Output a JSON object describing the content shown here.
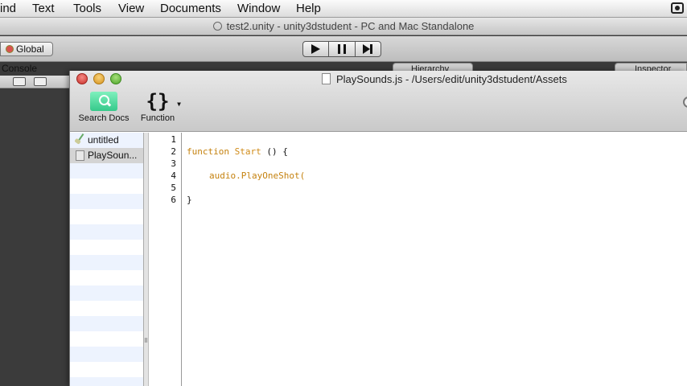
{
  "menu": [
    "ind",
    "Text",
    "Tools",
    "View",
    "Documents",
    "Window",
    "Help"
  ],
  "unity": {
    "title": "test2.unity - unity3dstudent - PC and Mac Standalone",
    "global_label": "Global",
    "console_tab": "Console",
    "hierarchy_tab": "Hierarchy",
    "inspector_tab": "Inspector"
  },
  "editor": {
    "title": "PlaySounds.js - /Users/edit/unity3dstudent/Assets",
    "tools": {
      "search_docs": "Search Docs",
      "function": "Function",
      "function_glyph": "{}"
    },
    "sidebar": [
      {
        "label": "untitled",
        "icon": "pen-icon"
      },
      {
        "label": "PlaySoun...",
        "icon": "file-icon"
      }
    ],
    "line_numbers": [
      "1",
      "2",
      "3",
      "4",
      "5",
      "6"
    ],
    "code": {
      "line2_kw": "function",
      "line2_name": "Start",
      "line2_rest": " () {",
      "line4_obj": "audio.",
      "line4_call": "PlayOneShot",
      "line4_rest": "(",
      "line6": "}"
    }
  },
  "colors": {
    "keyword": "#c5820f",
    "selection": "#d4d4d4",
    "alt_row": "#edf3fe"
  }
}
